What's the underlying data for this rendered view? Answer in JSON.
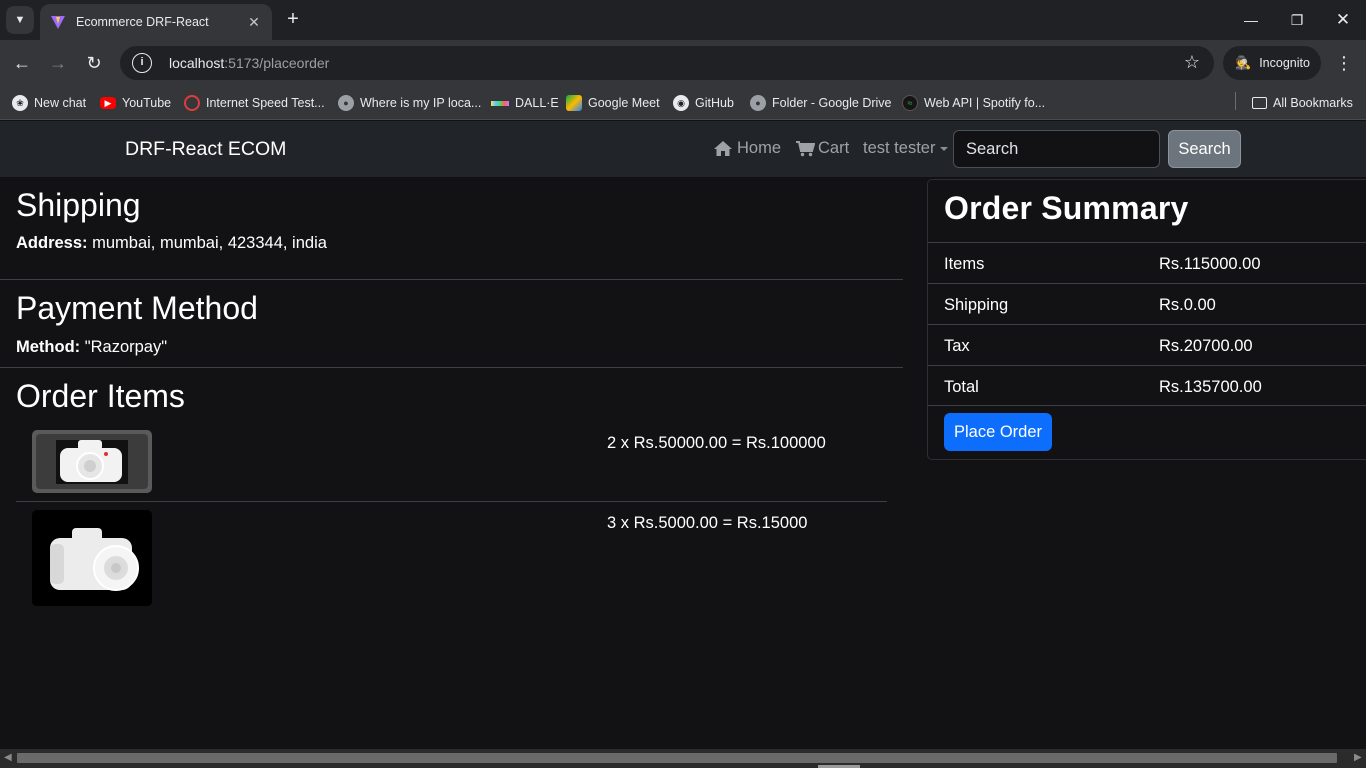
{
  "browser": {
    "tab_title": "Ecommerce DRF-React",
    "url_host": "localhost",
    "url_rest": ":5173/placeorder",
    "profile_label": "Incognito",
    "bookmarks": [
      {
        "label": "New chat",
        "icon": "openai-icon"
      },
      {
        "label": "YouTube",
        "icon": "youtube-icon"
      },
      {
        "label": "Internet Speed Test...",
        "icon": "speedtest-icon"
      },
      {
        "label": "Where is my IP loca...",
        "icon": "globe-icon"
      },
      {
        "label": "DALL·E",
        "icon": "dalle-icon"
      },
      {
        "label": "Google Meet",
        "icon": "meet-icon"
      },
      {
        "label": "GitHub",
        "icon": "github-icon"
      },
      {
        "label": "Folder - Google Drive",
        "icon": "globe-icon"
      },
      {
        "label": "Web API | Spotify fo...",
        "icon": "spotify-icon"
      }
    ],
    "all_bookmarks": "All Bookmarks"
  },
  "navbar": {
    "brand": "DRF-React ECOM",
    "home": "Home",
    "cart": "Cart",
    "user": "test tester",
    "search_placeholder": "Search",
    "search_button": "Search"
  },
  "shipping": {
    "heading": "Shipping",
    "address_label": "Address:",
    "address_value": " mumbai, mumbai, 423344, india"
  },
  "payment": {
    "heading": "Payment Method",
    "method_label": "Method:",
    "method_value": " \"Razorpay\""
  },
  "order_items": {
    "heading": "Order Items",
    "items": [
      {
        "text": "2 x Rs.50000.00 = Rs.100000"
      },
      {
        "text": "3 x Rs.5000.00 = Rs.15000"
      }
    ]
  },
  "summary": {
    "heading": "Order Summary",
    "rows": [
      {
        "label": "Items",
        "value": "Rs.115000.00"
      },
      {
        "label": "Shipping",
        "value": "Rs.0.00"
      },
      {
        "label": "Tax",
        "value": "Rs.20700.00"
      },
      {
        "label": "Total",
        "value": "Rs.135700.00"
      }
    ],
    "place_order": "Place Order"
  },
  "colors": {
    "navbar_bg": "#212529",
    "page_bg": "#121214",
    "primary": "#0d6efd",
    "secondary": "#6c757d"
  }
}
